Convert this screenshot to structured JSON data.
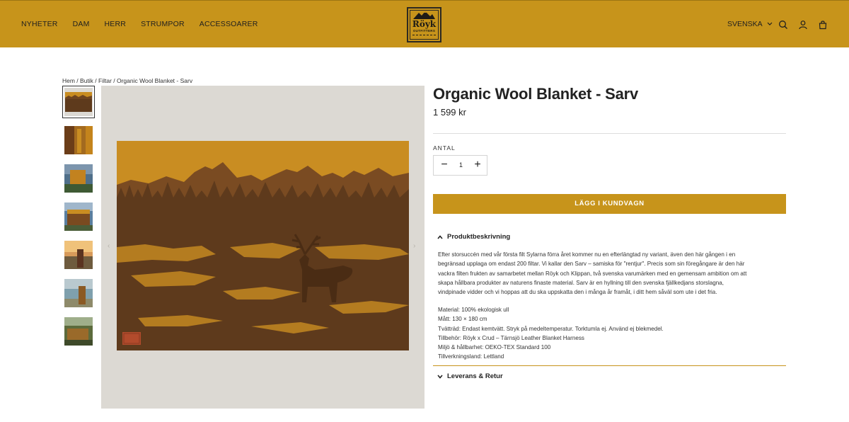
{
  "header": {
    "nav": [
      "NYHETER",
      "DAM",
      "HERR",
      "STRUMPOR",
      "ACCESSOARER"
    ],
    "logo": {
      "brand": "Röyk",
      "sub": "OUTFITTERS"
    },
    "language": "SVENSKA",
    "icons": [
      "search-icon",
      "account-icon",
      "cart-icon"
    ]
  },
  "breadcrumb": "Hem / Butik / Filtar / Organic Wool Blanket - Sarv",
  "product": {
    "title": "Organic Wool Blanket - Sarv",
    "price": "1 599 kr",
    "quantity_label": "ANTAL",
    "quantity": "1",
    "add_to_cart": "LÄGG I KUNDVAGN"
  },
  "accordion": {
    "description_title": "Produktbeskrivning",
    "description": [
      "Efter storsuccén med vår första filt Sylarna förra året kommer nu en efterlängtad ny variant, även den här gången i en",
      "begränsad upplaga om endast 200 filtar. Vi kallar den Sarv – samiska för \"rentjur\". Precis som sin föregångare är den här",
      "vackra filten frukten av samarbetet mellan Röyk och Klippan, två svenska varumärken med en gemensam ambition om att",
      "skapa hållbara produkter av naturens finaste material. Sarv är en hyllning till den svenska fjällkedjans storslagna,",
      "vindpinade vidder och vi hoppas att du ska uppskatta den i många år framåt, i ditt hem såväl som ute i det fria."
    ],
    "specs": [
      "Material: 100% ekologisk ull",
      "Mått: 130 × 180 cm",
      "Tvätträd: Endast kemtvätt. Stryk på medeltemperatur. Torktumla ej. Använd ej blekmedel.",
      "Tillbehör: Röyk x Crud – Tärnsjö Leather Blanket Harness",
      "Miljö & hållbarhet: OEKO-TEX Standard 100",
      "Tillverkningsland: Lettland"
    ],
    "shipping_title": "Leverans & Retur"
  },
  "colors": {
    "accent": "#c7941b",
    "blanket_dark": "#5e3a1c",
    "blanket_gold": "#c98d22"
  }
}
